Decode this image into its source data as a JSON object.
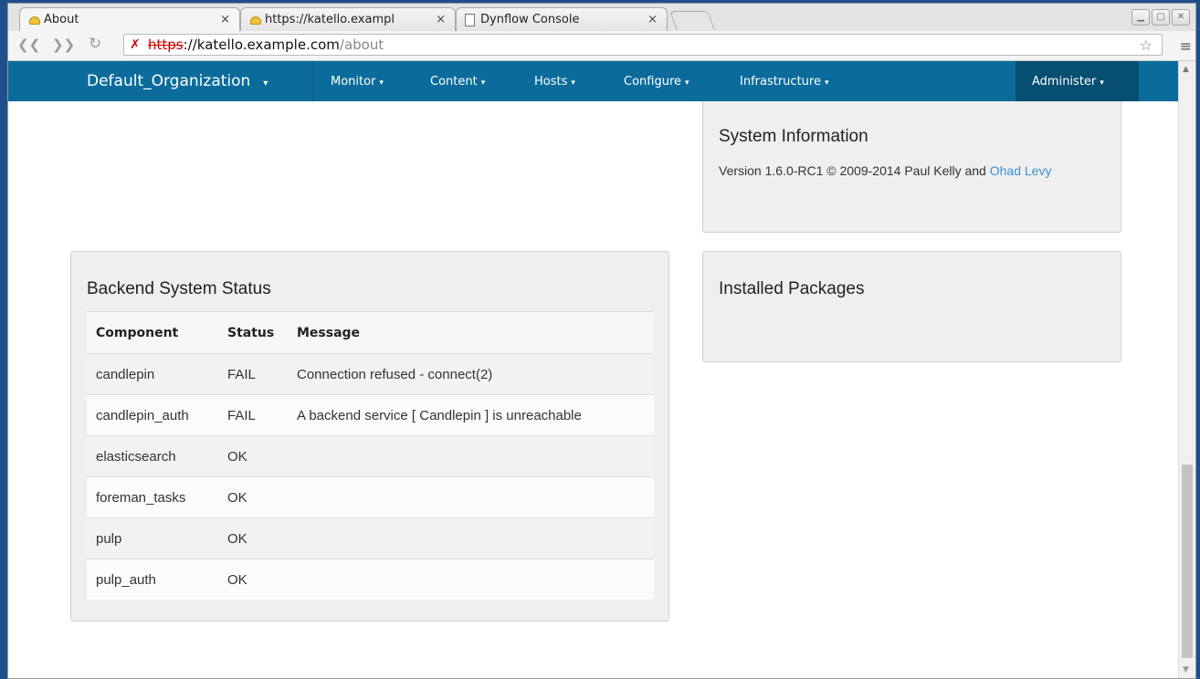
{
  "browser": {
    "tabs": [
      {
        "title": "About",
        "close": "×"
      },
      {
        "title": "https://katello.exampl",
        "close": "×"
      },
      {
        "title": "Dynflow Console",
        "close": "×"
      }
    ],
    "url": {
      "scheme": "https",
      "host": "://katello.example.com",
      "path": "/about"
    },
    "icons": {
      "back": "back-icon",
      "forward": "forward-icon",
      "reload": "reload-icon",
      "insecure": "insecure-lock-icon",
      "bookmark": "star-icon",
      "menu": "hamburger-menu-icon"
    }
  },
  "navbar": {
    "brand": "Default_Organization",
    "caret": "▾",
    "items": [
      "Monitor",
      "Content",
      "Hosts",
      "Configure",
      "Infrastructure"
    ],
    "admin": "Administer",
    "bg_color": "#0b6c9b"
  },
  "system_info": {
    "title": "System Information",
    "version_text": "Version 1.6.0-RC1 © 2009-2014 Paul Kelly and ",
    "author_link": "Ohad Levy"
  },
  "installed_packages": {
    "title": "Installed Packages"
  },
  "backend_status": {
    "title": "Backend System Status",
    "columns": [
      "Component",
      "Status",
      "Message"
    ],
    "rows": [
      {
        "component": "candlepin",
        "status": "FAIL",
        "message": "Connection refused - connect(2)"
      },
      {
        "component": "candlepin_auth",
        "status": "FAIL",
        "message": "A backend service [ Candlepin ] is unreachable"
      },
      {
        "component": "elasticsearch",
        "status": "OK",
        "message": ""
      },
      {
        "component": "foreman_tasks",
        "status": "OK",
        "message": ""
      },
      {
        "component": "pulp",
        "status": "OK",
        "message": ""
      },
      {
        "component": "pulp_auth",
        "status": "OK",
        "message": ""
      }
    ]
  }
}
